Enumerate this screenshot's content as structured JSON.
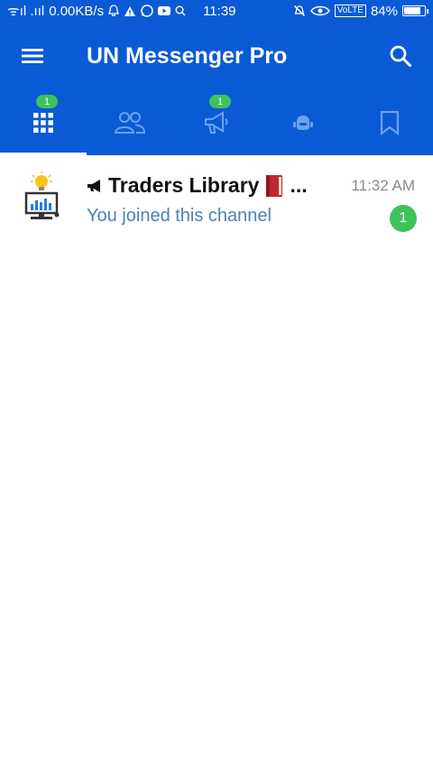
{
  "status_bar": {
    "signal_text": "ᯤıl .ııl",
    "data_speed": "0.00KB/s",
    "time": "11:39",
    "volte": "VoLTE",
    "battery": "84%",
    "battery_level": 0.84
  },
  "app_bar": {
    "title": "UN Messenger Pro",
    "menu_icon": "hamburger-menu-icon",
    "search_icon": "search-icon"
  },
  "tabs": [
    {
      "icon": "grid-icon",
      "badge": "1",
      "active": true
    },
    {
      "icon": "people-icon",
      "badge": "",
      "active": false
    },
    {
      "icon": "megaphone-icon",
      "badge": "1",
      "active": false
    },
    {
      "icon": "bot-icon",
      "badge": "",
      "active": false
    },
    {
      "icon": "bookmark-icon",
      "badge": "",
      "active": false
    }
  ],
  "chats": [
    {
      "name": "Traders Library",
      "name_suffix": "...",
      "time": "11:32 AM",
      "preview": "You joined this channel",
      "unread": "1",
      "icon": "megaphone-icon"
    }
  ],
  "colors": {
    "primary": "#0a5ad6",
    "badge_green": "#3cc35a",
    "preview_blue": "#4a83b8",
    "time_gray": "#8a8a8a"
  }
}
